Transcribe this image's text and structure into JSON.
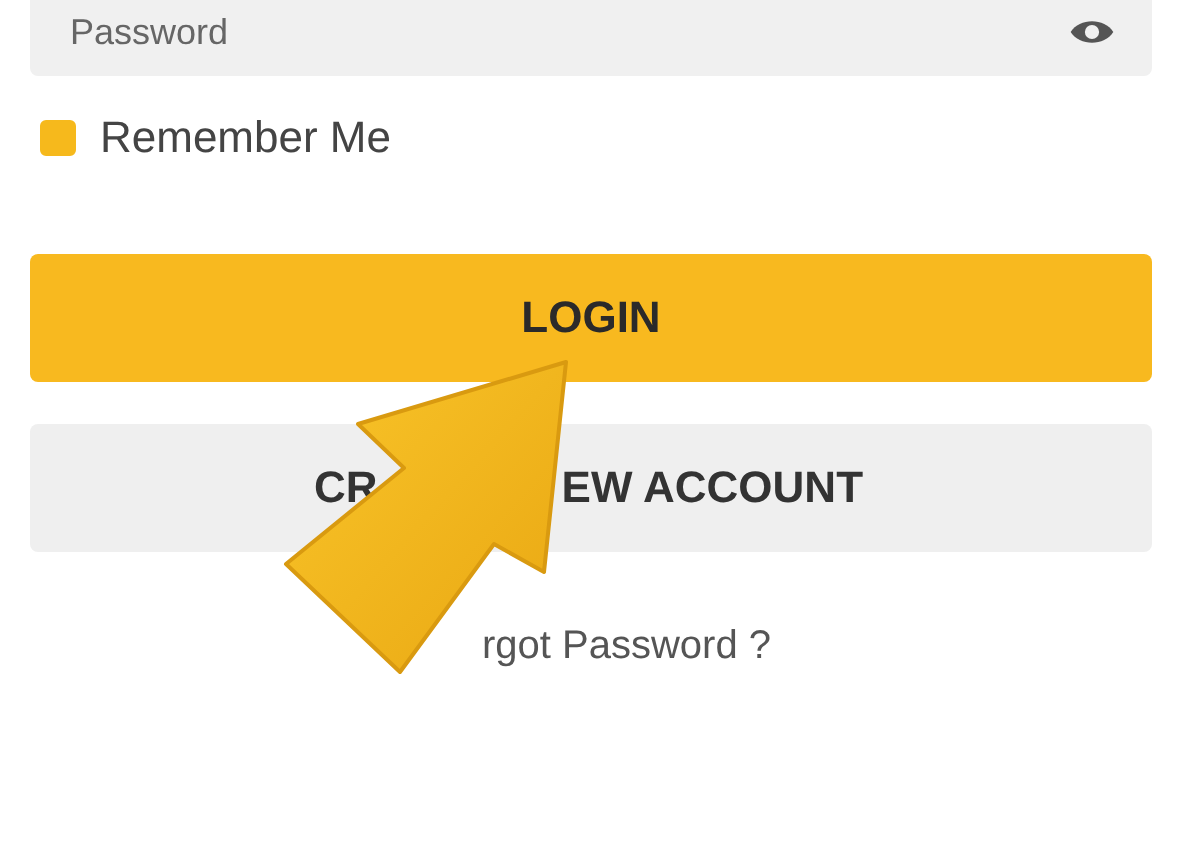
{
  "password_field": {
    "placeholder": "Password"
  },
  "remember_me": {
    "label": "Remember Me",
    "checked": true
  },
  "buttons": [
    {
      "label": "LOGIN",
      "kind": "primary"
    },
    {
      "label_start": "CR",
      "label_end": "EW ACCOUNT",
      "kind": "secondary"
    }
  ],
  "forgot_password": "rgot Password ?"
}
